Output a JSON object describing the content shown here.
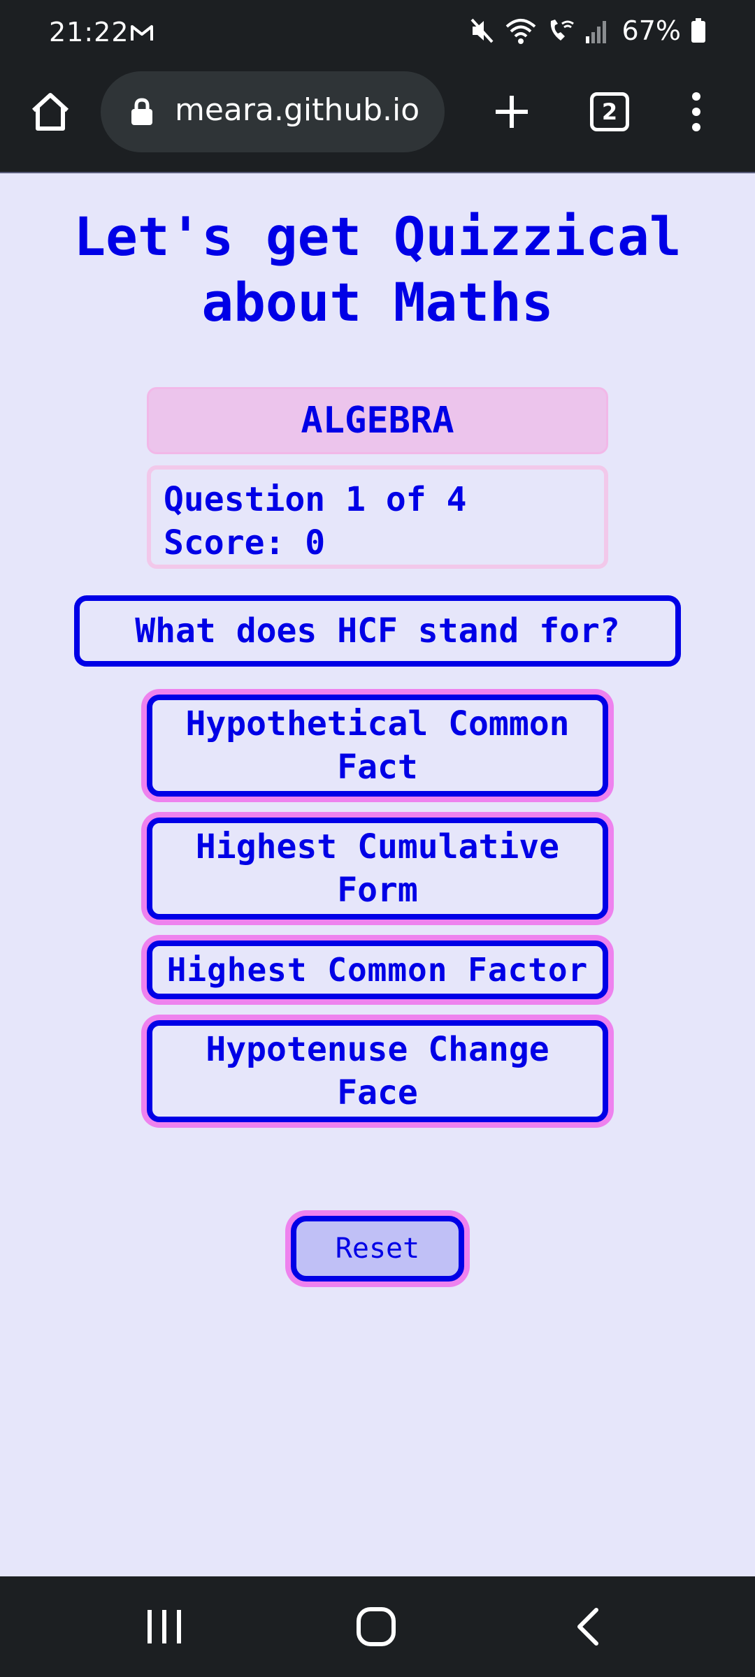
{
  "status_bar": {
    "time": "21:22",
    "battery": "67%",
    "icons": [
      "gmail-icon",
      "mute-icon",
      "wifi-icon",
      "wifi-calling-icon",
      "signal-icon",
      "battery-icon"
    ]
  },
  "browser": {
    "url": "meara.github.io",
    "tab_count": "2",
    "icons": [
      "home-icon",
      "lock-icon",
      "plus-icon",
      "more-vert-icon"
    ]
  },
  "page": {
    "title_line1": "Let's get Quizzical",
    "title_line2": "about Maths",
    "category": "ALGEBRA",
    "progress": "Question 1 of 4",
    "score": "Score: 0",
    "question": "What does HCF stand for?",
    "answers": [
      {
        "line1": "Hypothetical Common",
        "line2": "Fact"
      },
      {
        "line1": "Highest Cumulative",
        "line2": "Form"
      },
      {
        "line1": "Highest Common Factor",
        "line2": ""
      },
      {
        "line1": "Hypotenuse Change",
        "line2": "Face"
      }
    ],
    "reset_label": "Reset"
  },
  "colors": {
    "page_background": "#e6e6fa",
    "primary_blue": "#0000e6",
    "violet_outline": "#ee82ee",
    "category_fill": "#ecc4ec",
    "reset_fill": "#c0c0f6",
    "system_bar": "#1c1f22"
  },
  "nav_bar": {
    "icons": [
      "recents-icon",
      "home-circle-icon",
      "back-icon"
    ]
  }
}
